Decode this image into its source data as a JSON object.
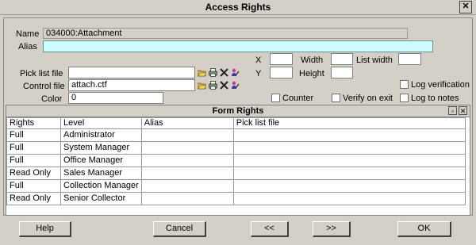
{
  "window": {
    "title": "Access Rights"
  },
  "form": {
    "name_label": "Name",
    "name_value": "034000:Attachment",
    "alias_label": "Alias",
    "alias_value": "",
    "picklist_label": "Pick list file",
    "picklist_value": "",
    "control_label": "Control file",
    "control_value": "attach.ctf",
    "color_label": "Color",
    "color_value": "0",
    "x_label": "X",
    "x_value": "",
    "y_label": "Y",
    "y_value": "",
    "width_label": "Width",
    "width_value": "",
    "height_label": "Height",
    "height_value": "",
    "listwidth_label": "List width",
    "listwidth_value": "",
    "log_verification_label": "Log verification",
    "counter_label": "Counter",
    "verify_on_exit_label": "Verify on exit",
    "log_to_notes_label": "Log to notes"
  },
  "form_rights": {
    "title": "Form Rights",
    "columns": [
      "Rights",
      "Level",
      "Alias",
      "Pick list file"
    ],
    "rows": [
      [
        "Full",
        "Administrator",
        "",
        ""
      ],
      [
        "Full",
        "System Manager",
        "",
        ""
      ],
      [
        "Full",
        "Office Manager",
        "",
        ""
      ],
      [
        "Read Only",
        "Sales Manager",
        "",
        ""
      ],
      [
        "Full",
        "Collection Manager",
        "",
        ""
      ],
      [
        "Read Only",
        "Senior Collector",
        "",
        ""
      ]
    ]
  },
  "buttons": {
    "help": "Help",
    "cancel": "Cancel",
    "prev": "<<",
    "next": ">>",
    "ok": "OK"
  },
  "icons": [
    "folder-open-icon",
    "printer-icon",
    "delete-x-icon",
    "person-edit-icon",
    "restore-icon",
    "close-icon"
  ]
}
